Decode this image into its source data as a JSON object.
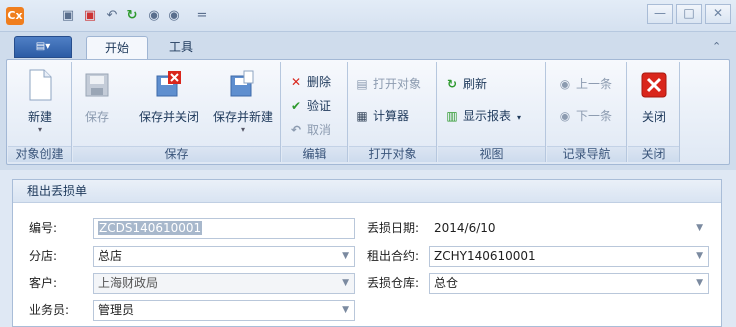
{
  "quick_access": {
    "app_icon_text": "Cx",
    "customize_symbol": "="
  },
  "window_controls": {
    "minimize": "—",
    "maximize": "□",
    "close": "✕"
  },
  "tabs": {
    "file": "▤▾",
    "home": "开始",
    "tools": "工具",
    "collapse": "⌃"
  },
  "ribbon": {
    "groups": {
      "create": {
        "label": "对象创建",
        "new": "新建"
      },
      "save": {
        "label": "保存",
        "save": "保存",
        "save_close": "保存并关闭",
        "save_new": "保存并新建"
      },
      "edit": {
        "label": "编辑",
        "delete": "删除",
        "verify": "验证",
        "cancel": "取消"
      },
      "open": {
        "label": "打开对象",
        "open_obj": "打开对象",
        "calculator": "计算器"
      },
      "view": {
        "label": "视图",
        "refresh": "刷新",
        "show_report": "显示报表"
      },
      "nav": {
        "label": "记录导航",
        "prev": "上一条",
        "next": "下一条"
      },
      "close": {
        "label": "关闭",
        "close": "关闭"
      }
    }
  },
  "form": {
    "title": "租出丢损单",
    "fields": {
      "no_label": "编号:",
      "no_value": "ZCDS140610001",
      "branch_label": "分店:",
      "branch_value": "总店",
      "customer_label": "客户:",
      "customer_value": "上海财政局",
      "salesman_label": "业务员:",
      "salesman_value": "管理员",
      "date_label": "丢损日期:",
      "date_value": "2014/6/10",
      "contract_label": "租出合约:",
      "contract_value": "ZCHY140610001",
      "warehouse_label": "丢损仓库:",
      "warehouse_value": "总仓"
    }
  },
  "colors": {
    "accent": "#2c5ca5",
    "delete_red": "#d9261c",
    "verify_green": "#2e9a2e"
  }
}
